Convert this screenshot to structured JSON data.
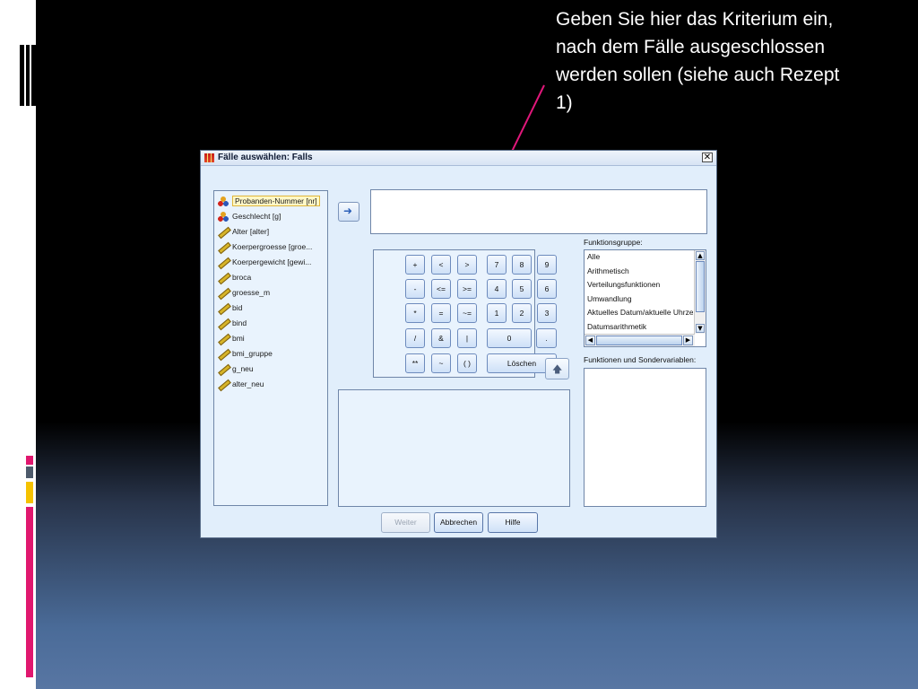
{
  "slide": {
    "note": "Geben Sie hier das Kriterium ein, nach dem Fälle ausgeschlossen werden sollen (siehe auch Rezept 1)"
  },
  "dialog": {
    "title": "Fälle auswählen: Falls",
    "close_glyph": "✕",
    "variables": [
      {
        "label": "Probanden-Nummer [nr]",
        "icon": "nominal-icon",
        "selected": true
      },
      {
        "label": "Geschlecht [g]",
        "icon": "nominal-icon"
      },
      {
        "label": "Alter [alter]",
        "icon": "scale-icon"
      },
      {
        "label": "Koerpergroesse [groe...",
        "icon": "scale-icon"
      },
      {
        "label": "Koerpergewicht [gewi...",
        "icon": "scale-icon"
      },
      {
        "label": "broca",
        "icon": "scale-icon"
      },
      {
        "label": "groesse_m",
        "icon": "scale-icon"
      },
      {
        "label": "bid",
        "icon": "scale-icon"
      },
      {
        "label": "bind",
        "icon": "scale-icon"
      },
      {
        "label": "bmi",
        "icon": "scale-icon"
      },
      {
        "label": "bmi_gruppe",
        "icon": "scale-icon"
      },
      {
        "label": "g_neu",
        "icon": "scale-icon"
      },
      {
        "label": "alter_neu",
        "icon": "scale-icon"
      }
    ],
    "keypad": {
      "rows": [
        [
          "+",
          "<",
          ">",
          "7",
          "8",
          "9"
        ],
        [
          "-",
          "<=",
          ">=",
          "4",
          "5",
          "6"
        ],
        [
          "*",
          "=",
          "~=",
          "1",
          "2",
          "3"
        ],
        [
          "/",
          "&",
          "|",
          "0",
          "."
        ],
        [
          "**",
          "~",
          "( )",
          "Löschen"
        ]
      ]
    },
    "function_group_label": "Funktionsgruppe:",
    "function_groups": [
      "Alle",
      "Arithmetisch",
      "Verteilungsfunktionen",
      "Umwandlung",
      "Aktuelles Datum/aktuelle Uhrzeit",
      "Datumsarithmetik"
    ],
    "functions_label": "Funktionen und Sondervariablen:",
    "buttons": {
      "weiter": "Weiter",
      "abbrechen": "Abbrechen",
      "hilfe": "Hilfe"
    },
    "colors": {
      "accent": "#2a5fb8",
      "panel": "#e9f3fd",
      "arrow": "#e0177a"
    }
  }
}
